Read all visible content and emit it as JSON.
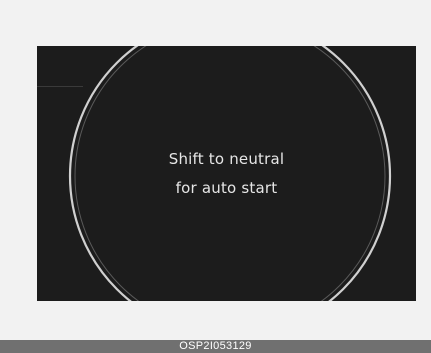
{
  "display": {
    "message_line1": "Shift to neutral",
    "message_line2": "for auto start",
    "background_color": "#1c1c1c",
    "ring_color": "#d8d8d8"
  },
  "caption": {
    "code": "OSP2I053129",
    "bar_color": "#707070"
  }
}
